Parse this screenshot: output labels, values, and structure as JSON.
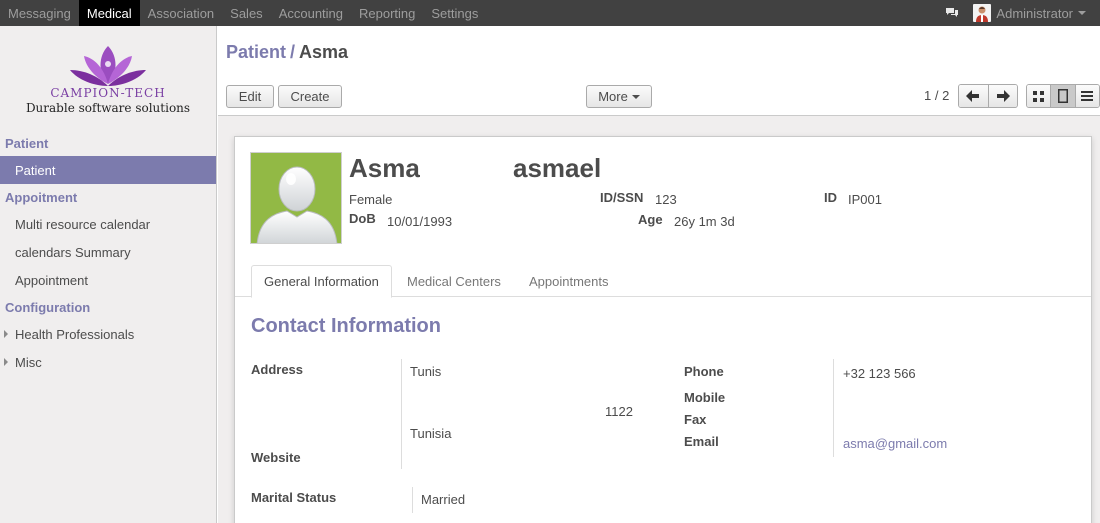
{
  "topbar": {
    "menu": [
      "Messaging",
      "Medical",
      "Association",
      "Sales",
      "Accounting",
      "Reporting",
      "Settings"
    ],
    "active_index": 1,
    "user": "Administrator"
  },
  "logo": {
    "brand": "CAMPION-TECH",
    "tagline": "Durable software solutions"
  },
  "sidebar": {
    "sections": [
      {
        "title": "Patient",
        "items": [
          {
            "label": "Patient",
            "active": true
          }
        ]
      },
      {
        "title": "Appoitment",
        "items": [
          {
            "label": "Multi resource calendar"
          },
          {
            "label": "calendars Summary"
          },
          {
            "label": "Appointment"
          }
        ]
      },
      {
        "title": "Configuration",
        "items": [
          {
            "label": "Health Professionals",
            "expandable": true
          },
          {
            "label": "Misc",
            "expandable": true
          }
        ]
      }
    ]
  },
  "header": {
    "breadcrumb_parent": "Patient",
    "breadcrumb_separator": "/",
    "breadcrumb_current": "Asma",
    "edit_label": "Edit",
    "create_label": "Create",
    "more_label": "More",
    "pager": "1 / 2"
  },
  "patient": {
    "first_name": "Asma",
    "last_name": "asmael",
    "gender": "Female",
    "dob_label": "DoB",
    "dob": "10/01/1993",
    "idssn_label": "ID/SSN",
    "idssn": "123",
    "age_label": "Age",
    "age": "26y 1m 3d",
    "id_label": "ID",
    "id": "IP001"
  },
  "tabs": [
    "General Information",
    "Medical Centers",
    "Appointments"
  ],
  "contact": {
    "title": "Contact Information",
    "address_label": "Address",
    "city": "Tunis",
    "zip": "1122",
    "country": "Tunisia",
    "website_label": "Website",
    "phone_label": "Phone",
    "phone": "+32 123 566",
    "mobile_label": "Mobile",
    "fax_label": "Fax",
    "email_label": "Email",
    "email": "asma@gmail.com",
    "marital_label": "Marital Status",
    "marital": "Married"
  },
  "colors": {
    "accent": "#7c7bad",
    "topbar": "#414141",
    "photo_bg": "#92b945"
  }
}
